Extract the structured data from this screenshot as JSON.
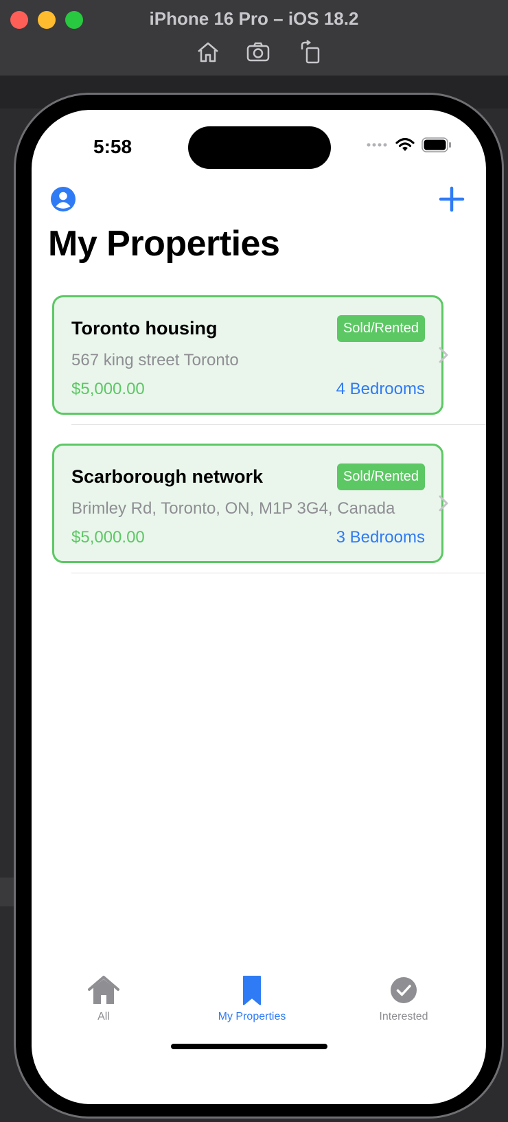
{
  "window": {
    "title": "iPhone 16 Pro – iOS 18.2",
    "toolbar": [
      "home-icon",
      "screenshot-icon",
      "rotate-icon"
    ]
  },
  "status_bar": {
    "time": "5:58"
  },
  "nav": {
    "title": "My Properties"
  },
  "colors": {
    "accent": "#2f7bf5",
    "sold_green": "#5cc864",
    "card_bg": "#eaf6ec",
    "secondary_text": "#8e8e93"
  },
  "properties": [
    {
      "name": "Toronto housing",
      "status": "Sold/Rented",
      "address": "567 king street Toronto",
      "price": "$5,000.00",
      "bedrooms": "4 Bedrooms"
    },
    {
      "name": "Scarborough network",
      "status": "Sold/Rented",
      "address": "Brimley Rd, Toronto, ON, M1P 3G4, Canada",
      "price": "$5,000.00",
      "bedrooms": "3 Bedrooms"
    }
  ],
  "tabs": [
    {
      "label": "All",
      "icon": "house-icon",
      "selected": false
    },
    {
      "label": "My Properties",
      "icon": "bookmark-icon",
      "selected": true
    },
    {
      "label": "Interested",
      "icon": "checkmark-circle-icon",
      "selected": false
    }
  ]
}
